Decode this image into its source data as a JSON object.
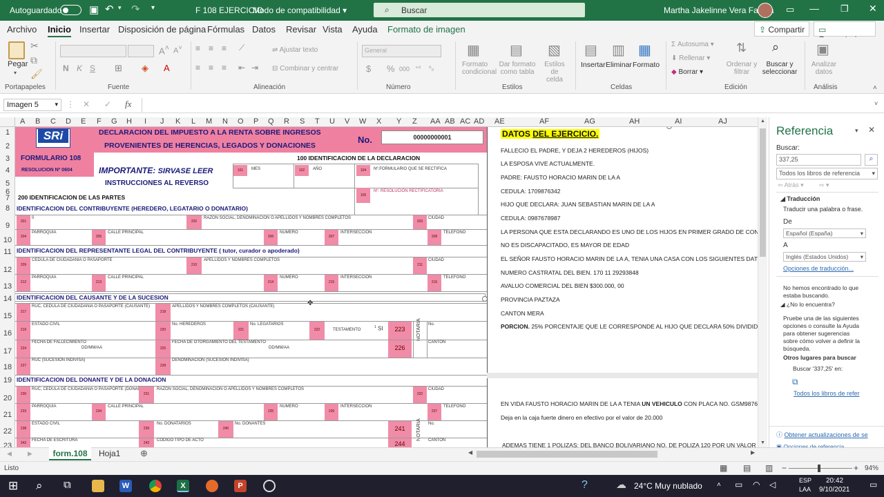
{
  "titlebar": {
    "autosave_label": "Autoguardado",
    "autosave_state": "Desactivado",
    "file_title": "F 108 EJERCICIO",
    "mode": "Modo de compatibilidad",
    "search_placeholder": "Buscar",
    "user_name": "Martha Jakelinne Vera Faubla"
  },
  "menu": {
    "items": [
      "Archivo",
      "Inicio",
      "Insertar",
      "Disposición de página",
      "Fórmulas",
      "Datos",
      "Revisar",
      "Vista",
      "Ayuda",
      "Formato de imagen"
    ],
    "active": "Inicio",
    "share": "Compartir",
    "comments": "Comentarios"
  },
  "ribbon": {
    "paste": "Pegar",
    "groups": [
      "Portapapeles",
      "Fuente",
      "Alineación",
      "Número",
      "Estilos",
      "Celdas",
      "Edición",
      "Análisis"
    ],
    "font_labels": [
      "N",
      "K",
      "S"
    ],
    "wrap_text": "Ajustar texto",
    "merge_center": "Combinar y centrar",
    "number_format": "General",
    "number_symbols": [
      "$",
      "%",
      "000"
    ],
    "cond_format": [
      "Formato",
      "condicional"
    ],
    "format_table": [
      "Dar formato",
      "como tabla"
    ],
    "cell_styles": [
      "Estilos de",
      "celda"
    ],
    "insert": "Insertar",
    "delete": "Eliminar",
    "format": "Formato",
    "autosum": "Autosuma",
    "fill": "Rellenar",
    "clear": "Borrar",
    "sort_filter": [
      "Ordenar y",
      "filtrar"
    ],
    "find_select": [
      "Buscar y",
      "seleccionar"
    ],
    "analyze": [
      "Analizar",
      "datos"
    ]
  },
  "formula_bar": {
    "name_box": "Imagen 5",
    "fx": "fx"
  },
  "columns": [
    "A",
    "B",
    "C",
    "D",
    "E",
    "F",
    "G",
    "H",
    "I",
    "J",
    "K",
    "L",
    "M",
    "N",
    "O",
    "P",
    "Q",
    "R",
    "S",
    "T",
    "U",
    "V",
    "W",
    "X",
    "Y",
    "Z",
    "AA",
    "AB",
    "AC",
    "AD",
    "AE",
    "AF",
    "AG",
    "AH",
    "AI",
    "AJ",
    "AK"
  ],
  "rows": [
    "1",
    "2",
    "3",
    "4",
    "5",
    "6",
    "7",
    "8",
    "9",
    "10",
    "11",
    "12",
    "13",
    "14",
    "15",
    "16",
    "17",
    "18",
    "19",
    "20",
    "21",
    "22",
    "23"
  ],
  "form": {
    "sri": "SRi",
    "header_line1": "DECLARACION DEL IMPUESTO A LA RENTA SOBRE INGRESOS",
    "header_line2": "PROVENIENTES DE HERENCIAS, LEGADOS Y DONACIONES",
    "no_label": "No.",
    "no_value": "00000000001",
    "form_title": "FORMULARIO 108",
    "resolution": "RESOLUCION Nº 0604",
    "important": "IMPORTANTE:",
    "important_rest": "SIRVASE  LEER",
    "instructions": "INSTRUCCIONES AL REVERSO",
    "sec100": "100 IDENTIFICACION DE LA DECLARACION",
    "f101": "101",
    "mes": "MES",
    "f102": "102",
    "anio": "AÑO",
    "f104": "104",
    "f104_label": "Nº.FORMULARIO QUE SE RECTIFICA",
    "f105": "105",
    "f105_label": "Nº. RESOLUCIÓN RECTIFICATORIA",
    "sec200": "200 IDENTIFICACION DE LAS PARTES",
    "contrib": "IDENTIFICACION DEL CONTRIBUYENTE (HEREDERO, LEGATARIO O DONATARIO)",
    "rep": "IDENTIFICACION DEL REPRESENTANTE LEGAL DEL CONTRIBUYENTE (  tutor, curador o apoderado)",
    "causante": "IDENTIFICACION DEL CAUSANTE Y DE LA SUCESION",
    "donante": "IDENTIFICACION DEL DONANTE Y DE LA DONACION",
    "razon_social": "RAZON SOCIAL, DENOMINACION O APELLIDOS Y NOMBRES COMPLETOS",
    "ciudad": "CIUDAD",
    "parroquia": "PARROQUIA",
    "calle": "CALLE PRINCIPAL",
    "numero": "NUMERO",
    "interseccion": "INTERSECCION",
    "telefono": "TELEFONO",
    "cedula": "CEDULA DE CIUDADANIA O PASAPORTE",
    "apellidos": "APELLIDOS Y NOMBRES COMPLETOS",
    "ruc_causante": "RUC, CEDULA DE CIUDADANIA O PASAPORTE (CAUSANTE)",
    "apellidos_causante": "APELLIDOS Y NOMBRES COMPLETOS (CAUSANTE)",
    "estado_civil": "ESTADO CIVIL",
    "no_herederos": "No. HEREDEROS",
    "no_legatarios": "No. LEGATARIOS",
    "testamento": "TESTAMENTO",
    "si": "SI",
    "f223": "223",
    "f226": "226",
    "notaria": "NOTARIA",
    "no": "No.",
    "canton": "CANTON",
    "fecha_fallecimiento": "FECHA DE FALLECIMIENTO",
    "ddmmaa": "DD/MM/AA",
    "fecha_testamento": "FECHA DE OTORGAMIENTO DEL TESTAMENTO",
    "ruc_sucesion": "RUC (SUCESION INDIVISA)",
    "denominacion": "DENOMINACION (SUCESION INDIVISA)",
    "ruc_donante": "RUC, CEDULA DE CIUDADANIA O PASAPORTE (DONANTE)",
    "no_donatarios": "No. DONATARIOS",
    "no_donantes": "No. DONANTES",
    "f241": "241",
    "fecha_escritura": "FECHA DE ESCRITURA",
    "codigo_acto": "CODIGO TIPO DE ACTO",
    "f244": "244",
    "codes_r9": [
      "201",
      "202",
      "203"
    ],
    "codes_r10": [
      "204",
      "205",
      "206",
      "207",
      "208"
    ],
    "codes_r12": [
      "209",
      "210",
      "211"
    ],
    "codes_r13": [
      "212",
      "213",
      "214",
      "215",
      "216"
    ],
    "codes_r15": [
      "217",
      "218"
    ],
    "codes_r16": [
      "219",
      "220",
      "221",
      "222"
    ],
    "codes_r17": [
      "224",
      "225"
    ],
    "codes_r18": [
      "227",
      "228"
    ],
    "codes_r20": [
      "230",
      "231",
      "232"
    ],
    "codes_r21": [
      "233",
      "234",
      "235",
      "236",
      "237"
    ],
    "codes_r22": [
      "238",
      "239",
      "240"
    ],
    "codes_r23": [
      "242",
      "243"
    ]
  },
  "exercise": {
    "title": "DATOS",
    "title_rest": "DEL  EJERCICIO.",
    "lines": [
      "FALLECIO EL PADRE, Y DEJA  2 HEREDEROS (HIJOS)",
      "LA ESPOSA VIVE ACTUALMENTE.",
      "PADRE: FAUSTO HORACIO MARIN DE LA A",
      "CEDULA: 1709876342",
      "HIJO QUE DECLARA:  JUAN SEBASTIAN MARIN DE LA A",
      "CEDULA: 0987678987",
      "LA PERSONA QUE ESTA DECLARANDO ES UNO DE LOS HIJOS EN PRIMER GRADO DE CONSAGUIN",
      "NO ES DISCAPACITADO, ES MAYOR  DE EDAD",
      "EL SEÑOR FAUSTO HORACIO MARIN DE LA A, TENIA UNA CASA CON LOS SIGUIENTES DATOS:",
      "NUMERO CASTRATAL DEL BIEN. 170 11 29293848",
      "AVALUO COMERCIAL DEL BIEN $300.000, 00",
      "PROVINCIA PAZTAZA",
      "CANTON MERA"
    ],
    "porcion_label": "PORCION.",
    "porcion_text": "25% PORCENTAJE QUE LE CORRESPONDE AL HIJO QUE DECLARA 50% DIVIDIDO PARA",
    "vehicle_pre": "EN VIDA FAUSTO HORACIO MARIN DE LA A TENIA",
    "vehicle_bold": "UN VEHICULO",
    "vehicle_post": "CON PLACA NO. GSM9876 AV",
    "cash": "Deja en la caja fuerte dinero en efectivo por el valor de 20.000",
    "policies": "ADEMAS TIENE 1 POLIZAS:   DEL BANCO BOLIVARIANO NO. DE POLIZA 120  POR UN VALOR DE"
  },
  "pane": {
    "title": "Referencia",
    "search_label": "Buscar:",
    "search_value": "337,25",
    "scope": "Todos los libros de referencia",
    "back": "Atrás",
    "translation": "Traducción",
    "translate_hint": "Traducir una palabra o frase.",
    "from_label": "De",
    "from_value": "Español (España)",
    "to_label": "A",
    "to_value": "Inglés (Estados Unidos)",
    "options_link": "Opciones de traducción...",
    "not_found": "No hemos encontrado lo que estaba buscando.",
    "not_found_q": "¿No lo encuentra?",
    "suggest": "Pruebe una de las siguientes opciones o consulte la Ayuda para obtener sugerencias sobre cómo volver a definir la búsqueda.",
    "other_places": "Otros lugares para buscar",
    "search_in": "Buscar '337,25' en:",
    "all_books": "Todos los libros de refer",
    "updates": "Obtener actualizaciones de se",
    "ref_options": "Opciones de referencia..."
  },
  "sheet_tabs": {
    "active": "form.108",
    "other": "Hoja1"
  },
  "status": {
    "text": "Listo",
    "zoom": "94%"
  },
  "taskbar": {
    "weather": "24°C  Muy nublado",
    "lang1": "ESP",
    "lang2": "LAA",
    "time": "20:42",
    "date": "9/10/2021"
  },
  "colors": {
    "excel_green": "#217346",
    "form_pink": "#f080a0",
    "form_navy": "#1a1a7a",
    "highlight_yellow": "#ffff00"
  }
}
